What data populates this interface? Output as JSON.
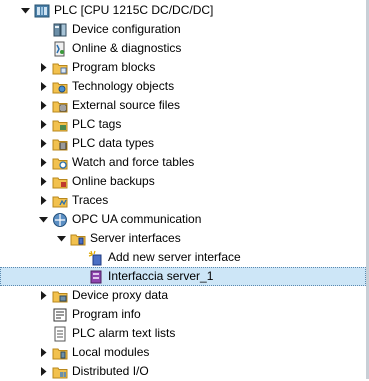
{
  "tree": {
    "root": {
      "label": "PLC [CPU 1215C DC/DC/DC]"
    },
    "items": [
      {
        "label": "Device configuration"
      },
      {
        "label": "Online & diagnostics"
      },
      {
        "label": "Program blocks"
      },
      {
        "label": "Technology objects"
      },
      {
        "label": "External source files"
      },
      {
        "label": "PLC tags"
      },
      {
        "label": "PLC data types"
      },
      {
        "label": "Watch and force tables"
      },
      {
        "label": "Online backups"
      },
      {
        "label": "Traces"
      },
      {
        "label": "OPC UA communication"
      },
      {
        "label": "Server interfaces"
      },
      {
        "label": "Add new server interface"
      },
      {
        "label": "Interfaccia server_1"
      },
      {
        "label": "Device proxy data"
      },
      {
        "label": "Program info"
      },
      {
        "label": "PLC alarm text lists"
      },
      {
        "label": "Local modules"
      },
      {
        "label": "Distributed I/O"
      }
    ]
  }
}
